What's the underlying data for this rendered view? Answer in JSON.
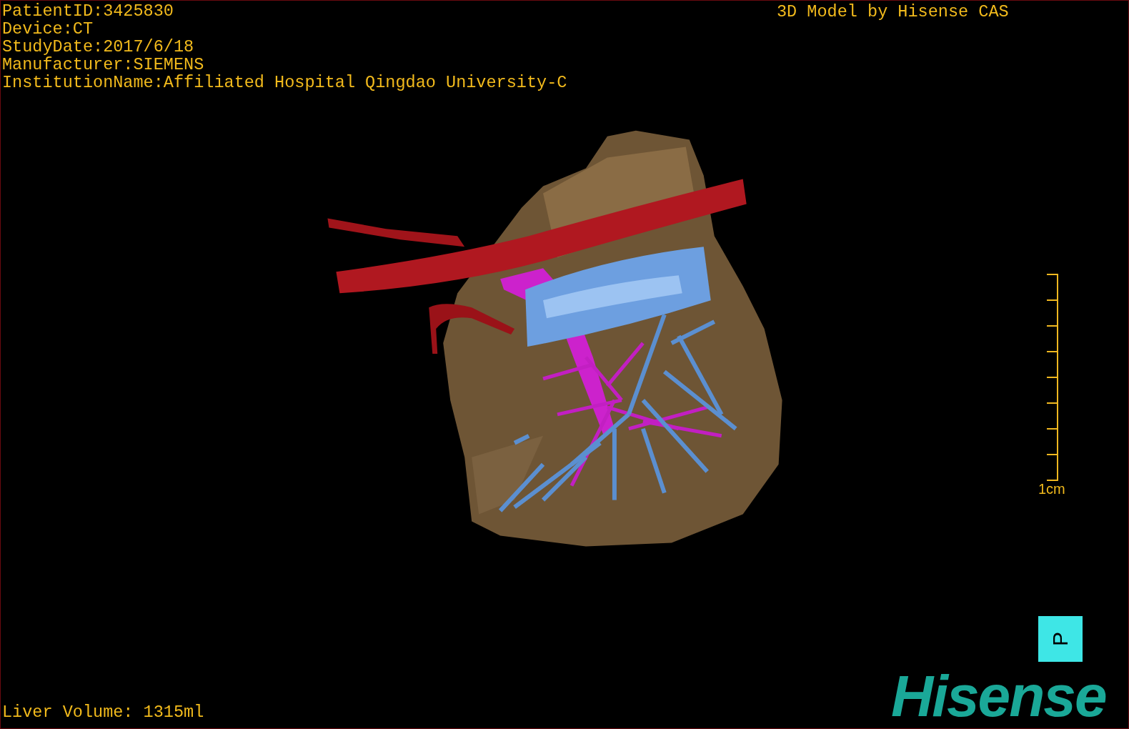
{
  "patient_info": [
    "PatientID:3425830",
    "Device:CT",
    "StudyDate:2017/6/18",
    "Manufacturer:SIEMENS",
    "InstitutionName:Affiliated Hospital Qingdao University-C"
  ],
  "model_credit": "3D Model by Hisense CAS",
  "scale_bar": {
    "label": "1cm"
  },
  "orientation_marker": {
    "label": "P"
  },
  "logo": "Hisense",
  "liver_volume": "Liver Volume: 1315ml"
}
